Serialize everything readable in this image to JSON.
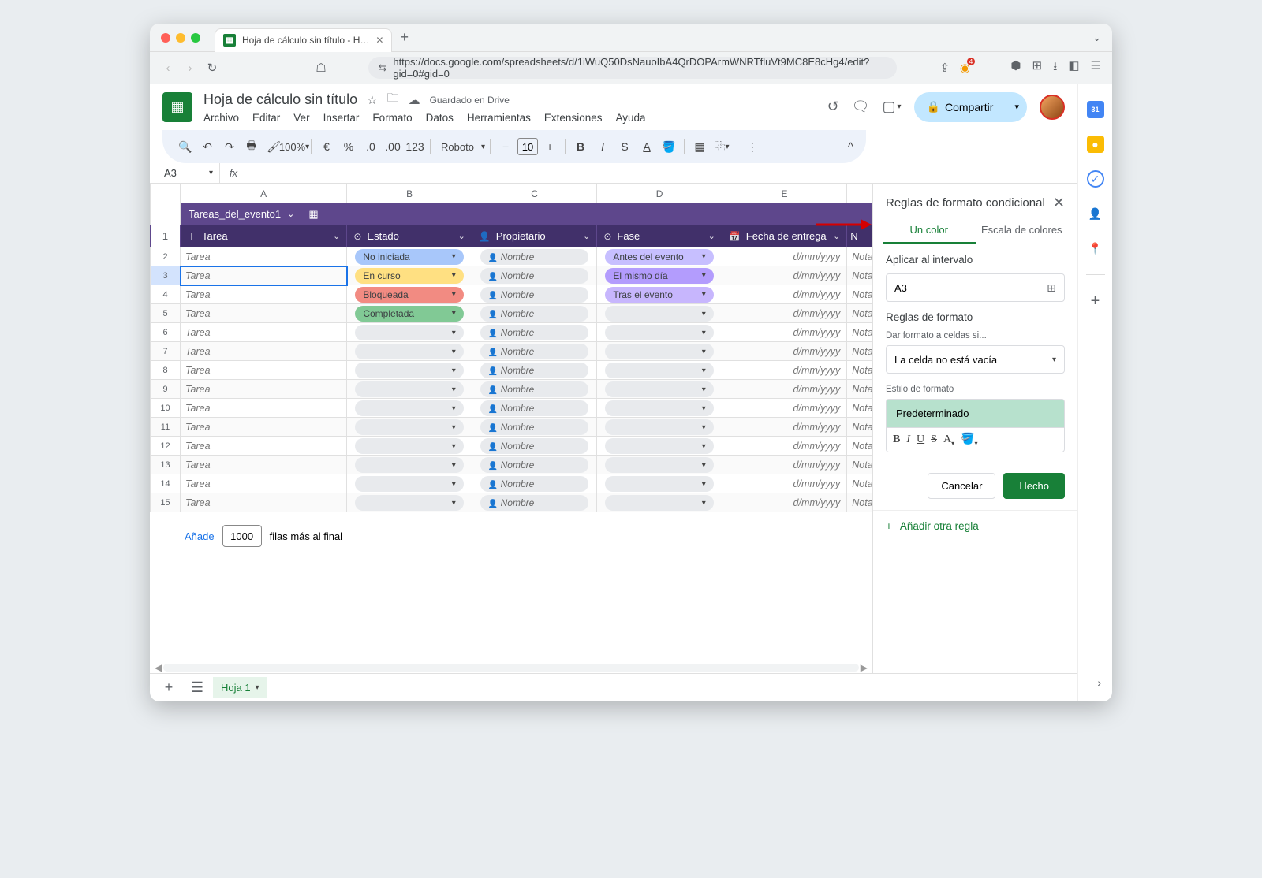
{
  "browser": {
    "tab_title": "Hoja de cálculo sin título - H…",
    "url": "https://docs.google.com/spreadsheets/d/1iWuQ50DsNauoIbA4QrDOPArmWNRTfluVt9MC8E8cHg4/edit?gid=0#gid=0"
  },
  "app": {
    "doc_title": "Hoja de cálculo sin título",
    "saved_text": "Guardado en Drive",
    "menus": [
      "Archivo",
      "Editar",
      "Ver",
      "Insertar",
      "Formato",
      "Datos",
      "Herramientas",
      "Extensiones",
      "Ayuda"
    ],
    "share_label": "Compartir",
    "zoom": "100%",
    "font": "Roboto",
    "font_size": "10",
    "name_box": "A3",
    "collapse_chev": "^"
  },
  "columns": [
    "",
    "A",
    "B",
    "C",
    "D",
    "E",
    ""
  ],
  "table_tab": "Tareas_del_evento1",
  "headers": {
    "a": "Tarea",
    "b": "Estado",
    "c": "Propietario",
    "d": "Fase",
    "e": "Fecha de entrega",
    "f": "N"
  },
  "pills": {
    "no_iniciada": "No iniciada",
    "en_curso": "En curso",
    "bloqueada": "Bloqueada",
    "completada": "Completada",
    "antes": "Antes del evento",
    "mismo": "El mismo día",
    "tras": "Tras el evento"
  },
  "cell_defaults": {
    "tarea": "Tarea",
    "nombre": "Nombre",
    "fecha": "d/mm/yyyy",
    "notas": "Notas"
  },
  "rows": [
    {
      "n": 2,
      "estado": "no_iniciada",
      "fase": "antes"
    },
    {
      "n": 3,
      "estado": "en_curso",
      "fase": "mismo",
      "selected": true
    },
    {
      "n": 4,
      "estado": "bloqueada",
      "fase": "tras"
    },
    {
      "n": 5,
      "estado": "completada",
      "fase": ""
    },
    {
      "n": 6,
      "estado": "",
      "fase": ""
    },
    {
      "n": 7,
      "estado": "",
      "fase": ""
    },
    {
      "n": 8,
      "estado": "",
      "fase": ""
    },
    {
      "n": 9,
      "estado": "",
      "fase": ""
    },
    {
      "n": 10,
      "estado": "",
      "fase": ""
    },
    {
      "n": 11,
      "estado": "",
      "fase": ""
    },
    {
      "n": 12,
      "estado": "",
      "fase": ""
    },
    {
      "n": 13,
      "estado": "",
      "fase": ""
    },
    {
      "n": 14,
      "estado": "",
      "fase": ""
    },
    {
      "n": 15,
      "estado": "",
      "fase": ""
    }
  ],
  "add_rows": {
    "link": "Añade",
    "count": "1000",
    "suffix": "filas más al final"
  },
  "sheet_tab": "Hoja 1",
  "panel": {
    "title": "Reglas de formato condicional",
    "tab1": "Un color",
    "tab2": "Escala de colores",
    "apply_label": "Aplicar al intervalo",
    "range": "A3",
    "rules_label": "Reglas de formato",
    "format_if_label": "Dar formato a celdas si...",
    "condition": "La celda no está vacía",
    "style_label": "Estilo de formato",
    "style_preview": "Predeterminado",
    "cancel": "Cancelar",
    "done": "Hecho",
    "add_rule": "Añadir otra regla"
  }
}
